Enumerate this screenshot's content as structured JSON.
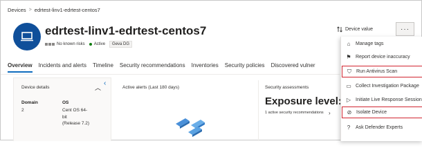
{
  "breadcrumb": {
    "root": "Devices",
    "separator": ">",
    "current": "edrtest-linv1-edrtest-centos7"
  },
  "device": {
    "name": "edrtest-linv1-edrtest-centos7",
    "risk_text": "No known risks",
    "status": "Active",
    "tag": "Geva DG"
  },
  "header_actions": {
    "device_value": "Device value",
    "more": "···"
  },
  "tabs": [
    {
      "label": "Overview",
      "active": true
    },
    {
      "label": "Incidents and alerts"
    },
    {
      "label": "Timeline"
    },
    {
      "label": "Security recommendations"
    },
    {
      "label": "Inventories"
    },
    {
      "label": "Security policies"
    },
    {
      "label": "Discovered vulner"
    }
  ],
  "device_details": {
    "title": "Device details",
    "domain_label": "Domain",
    "domain_value": "2",
    "os_label": "OS",
    "os_lines": [
      "Cent OS 64-",
      "bit",
      "(Release 7.2)"
    ]
  },
  "alerts_card": {
    "title": "Active alerts (Last 180 days)"
  },
  "security_card": {
    "title": "Security assessments",
    "exposure_prefix": "Exposure level: ",
    "exposure_level": "L",
    "subtitle": "1 active security recommendations"
  },
  "menu": {
    "items": [
      {
        "label": "Manage tags",
        "icon": "tag-icon",
        "glyph": "⌂",
        "highlighted": false
      },
      {
        "label": "Report device inaccuracy",
        "icon": "flag-icon",
        "glyph": "⚑",
        "highlighted": false
      },
      {
        "label": "Run Antivirus Scan",
        "icon": "shield-icon",
        "glyph": "⛉",
        "highlighted": true
      },
      {
        "label": "Collect Investigation Package",
        "icon": "package-icon",
        "glyph": "▭",
        "highlighted": false
      },
      {
        "label": "Initiate Live Response Session",
        "icon": "play-icon",
        "glyph": "▷",
        "highlighted": false
      },
      {
        "label": "Isolate Device",
        "icon": "block-icon",
        "glyph": "⊘",
        "highlighted": true
      },
      {
        "label": "Ask Defender Experts",
        "icon": "question-icon",
        "glyph": "?",
        "highlighted": false
      }
    ]
  },
  "colors": {
    "accent": "#0f6cbd",
    "device_icon_bg": "#0f4f9a",
    "highlight": "#d1242f",
    "active_dot": "#107c10",
    "exposure_level": "#ff8c00"
  }
}
